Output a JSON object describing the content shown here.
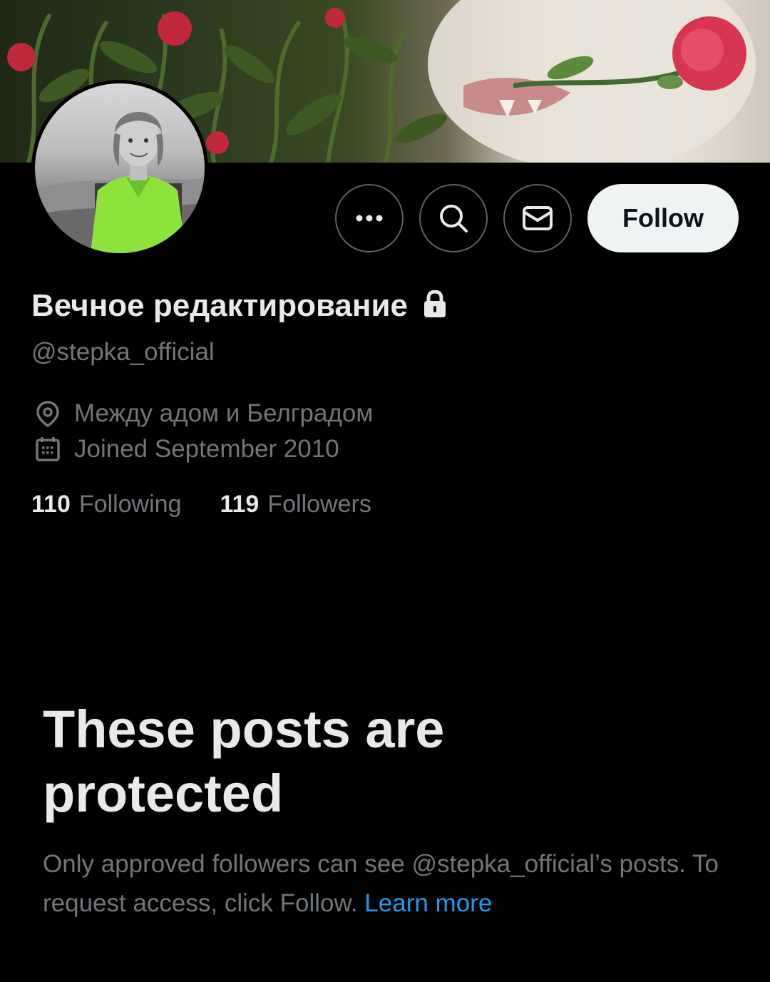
{
  "profile": {
    "display_name": "Вечное редактирование",
    "handle": "@stepka_official",
    "location": "Между адом и Белградом",
    "joined": "Joined September 2010",
    "following_count": "110",
    "following_label": "Following",
    "followers_count": "119",
    "followers_label": "Followers"
  },
  "actions": {
    "more_icon": "more-icon",
    "search_icon": "search-icon",
    "message_icon": "mail-icon",
    "follow_label": "Follow"
  },
  "protected": {
    "title": "These posts are protected",
    "body": "Only approved followers can see @stepka_official’s posts. To request access, click Follow.",
    "learn_more": "Learn more"
  },
  "colors": {
    "background": "#000000",
    "primary_text": "#e7e9ea",
    "secondary_text": "#71767b",
    "link": "#1d9bf0",
    "follow_bg": "#eff3f4"
  }
}
